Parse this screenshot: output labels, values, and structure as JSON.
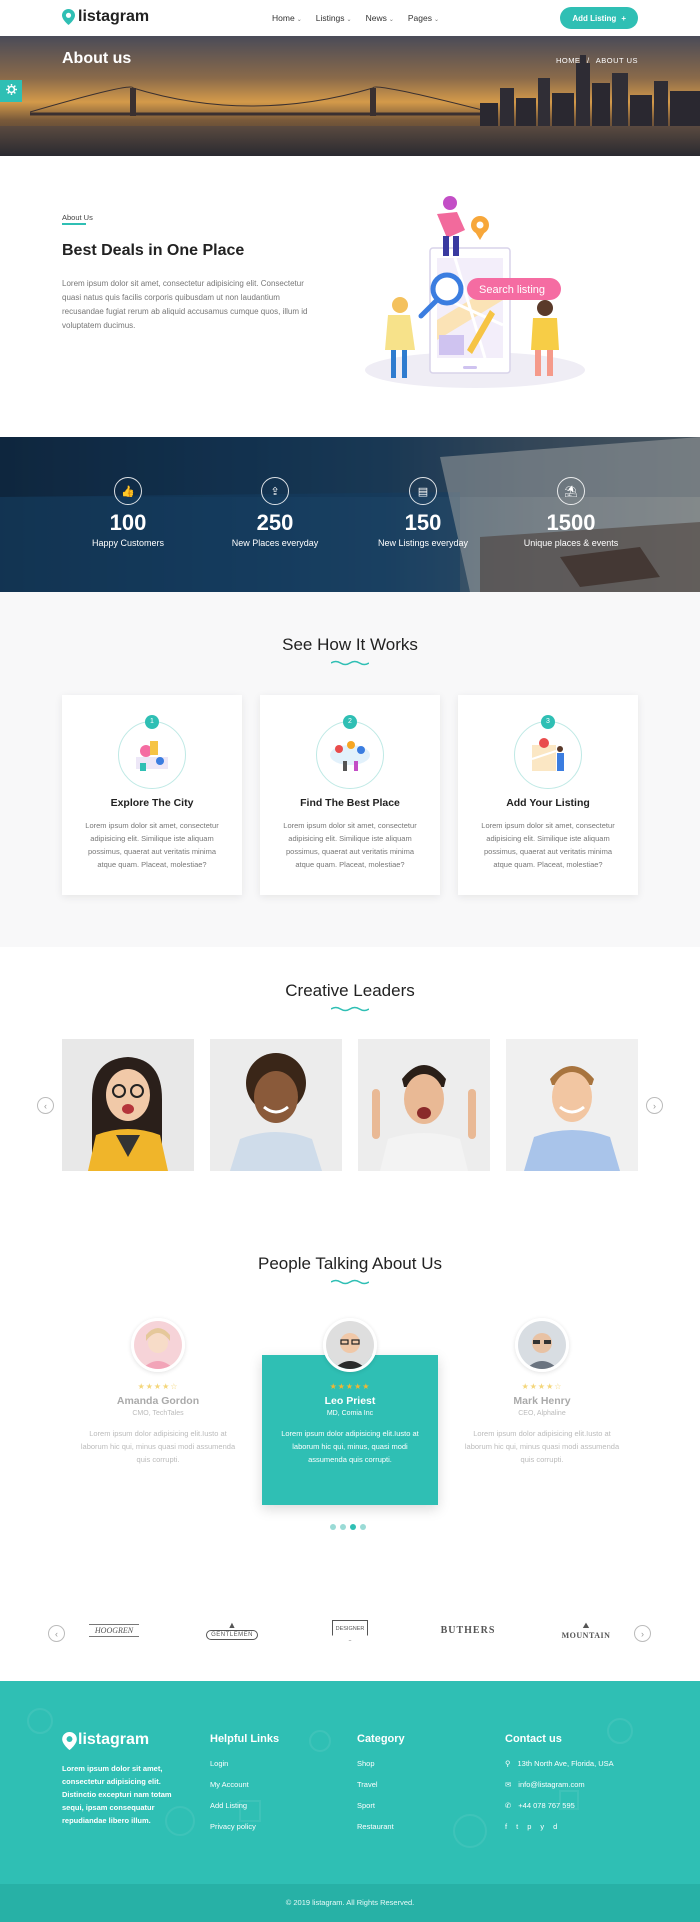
{
  "header": {
    "logo": "listagram",
    "nav": [
      "Home",
      "Listings",
      "News",
      "Pages"
    ],
    "add_listing": "Add Listing"
  },
  "hero": {
    "title": "About us",
    "breadcrumb": [
      "HOME",
      "/",
      "ABOUT US"
    ]
  },
  "about": {
    "label": "About Us",
    "heading": "Best Deals in One Place",
    "text": "Lorem ipsum dolor sit amet, consectetur adipisicing elit. Consectetur quasi natus quis facilis corporis quibusdam ut non laudantium recusandae fugiat rerum ab aliquid accusamus cumque quos, illum id voluptatem ducimus.",
    "illustration_label": "Search listing"
  },
  "stats": [
    {
      "icon": "thumbs-up-icon",
      "value": "100",
      "label": "Happy Customers"
    },
    {
      "icon": "upload-icon",
      "value": "250",
      "label": "New Places everyday"
    },
    {
      "icon": "book-icon",
      "value": "150",
      "label": "New Listings everyday"
    },
    {
      "icon": "island-icon",
      "value": "1500",
      "label": "Unique places & events"
    }
  ],
  "how": {
    "title": "See How It Works",
    "steps": [
      {
        "num": "1",
        "title": "Explore The City",
        "text": "Lorem ipsum dolor sit amet, consectetur adipisicing elit. Similique iste aliquam possimus, quaerat aut veritatis minima atque quam. Placeat, molestiae?"
      },
      {
        "num": "2",
        "title": "Find The Best Place",
        "text": "Lorem ipsum dolor sit amet, consectetur adipisicing elit. Similique iste aliquam possimus, quaerat aut veritatis minima atque quam. Placeat, molestiae?"
      },
      {
        "num": "3",
        "title": "Add Your Listing",
        "text": "Lorem ipsum dolor sit amet, consectetur adipisicing elit. Similique iste aliquam possimus, quaerat aut veritatis minima atque quam. Placeat, molestiae?"
      }
    ]
  },
  "leaders": {
    "title": "Creative Leaders"
  },
  "testimonials": {
    "title": "People Talking About Us",
    "items": [
      {
        "name": "Amanda Gordon",
        "role": "CMO, TechTales",
        "stars": "★★★★☆",
        "text": "Lorem ipsum dolor adipisicing elit.Iusto at laborum hic qui, minus quasi modi assumenda quis corrupti."
      },
      {
        "name": "Leo Priest",
        "role": "MD, Comia Inc",
        "stars": "★★★★★",
        "text": "Lorem ipsum dolor adipisicing elit.Iusto at laborum hic qui, minus, quasi modi assumenda quis corrupti."
      },
      {
        "name": "Mark Henry",
        "role": "CEO, Alphaline",
        "stars": "★★★★☆",
        "text": "Lorem ipsum dolor adipisicing elit.Iusto at laborum hic qui, minus quasi modi assumenda quis corrupti."
      }
    ]
  },
  "brands": [
    "HOOGREN",
    "GENTLEMEN",
    "DESIGNER",
    "BUTHERS",
    "MOUNTAIN"
  ],
  "footer": {
    "logo": "listagram",
    "about": "Lorem ipsum dolor sit amet, consectetur adipisicing elit. Distinctio excepturi nam totam sequi, ipsam consequatur repudiandae libero illum.",
    "helpful_title": "Helpful Links",
    "helpful": [
      "Login",
      "My Account",
      "Add Listing",
      "Privacy policy"
    ],
    "category_title": "Category",
    "categories": [
      "Shop",
      "Travel",
      "Sport",
      "Restaurant"
    ],
    "contact_title": "Contact us",
    "address": "13th North Ave, Florida, USA",
    "email": "info@listagram.com",
    "phone": "+44 078 767 595",
    "socials": [
      "f",
      "t",
      "p",
      "y",
      "d"
    ],
    "copyright": "© 2019 listagram. All Rights Reserved."
  },
  "colors": {
    "accent": "#2fbfb4"
  }
}
